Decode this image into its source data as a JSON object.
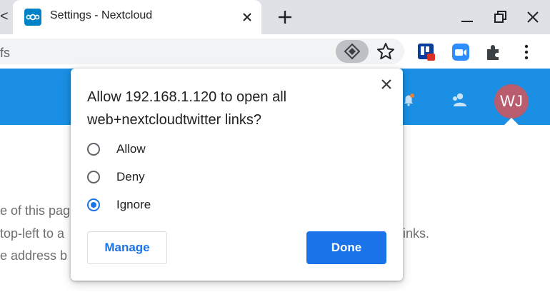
{
  "browser": {
    "tab_left_edge": "<",
    "tab": {
      "title": "Settings - Nextcloud",
      "favicon": "nextcloud-logo-icon"
    },
    "url_fragment": "fs",
    "icons": [
      "tab-close-icon",
      "new-tab-plus-icon",
      "minimize-icon",
      "restore-icon",
      "window-close-icon",
      "protocol-handler-icon",
      "star-icon",
      "trello-extension-icon",
      "zoom-extension-icon",
      "extensions-puzzle-icon",
      "more-vert-icon"
    ]
  },
  "page": {
    "header_color": "#1a8fe3",
    "avatar_initials": "WJ",
    "avatar_color": "#b85c6e",
    "lines": [
      "e of this pag",
      "top-left to a",
      "e address b"
    ],
    "right_fragment": "inks."
  },
  "dialog": {
    "title": "Allow 192.168.1.120 to open all web+nextcloudtwitter links?",
    "options": [
      {
        "label": "Allow",
        "checked": false
      },
      {
        "label": "Deny",
        "checked": false
      },
      {
        "label": "Ignore",
        "checked": true
      }
    ],
    "manage_label": "Manage",
    "done_label": "Done",
    "accent": "#1a73e8"
  }
}
